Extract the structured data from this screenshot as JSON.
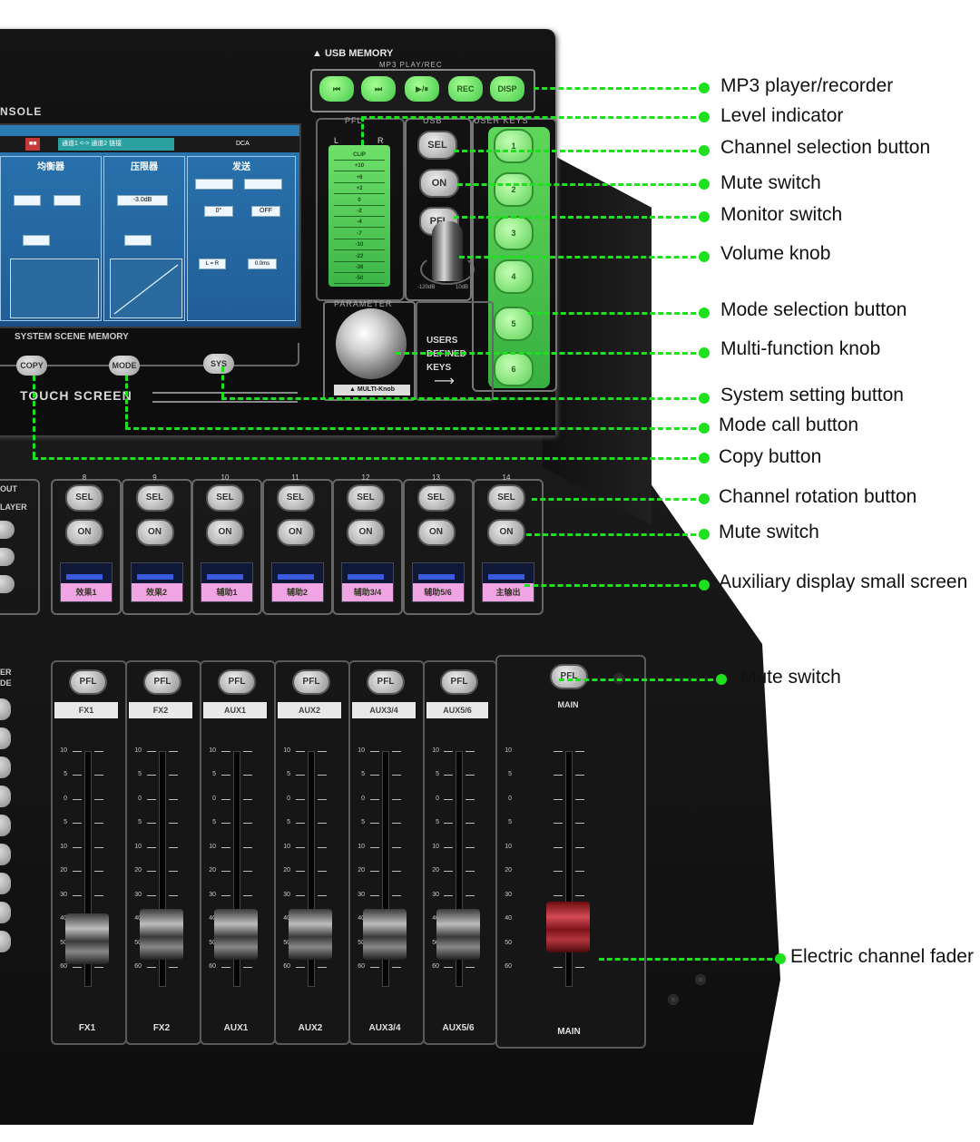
{
  "console": {
    "title": "NSOLE",
    "usb_memory_label": "USB MEMORY",
    "mp3_label": "MP3 PLAY/REC",
    "mp3_buttons": [
      "⏮",
      "⏭",
      "▶/⏸",
      "REC",
      "DISP"
    ],
    "section_labels": {
      "pfl": "PFL",
      "usb": "USB",
      "user_keys": "USER KEYS",
      "parameter": "PARAMETER"
    },
    "meter_labels": [
      "CLIP",
      "+10",
      "+6",
      "+2",
      "0",
      "-2",
      "-4",
      "-7",
      "-10",
      "-22",
      "-38",
      "-50"
    ],
    "usb_buttons": [
      "SEL",
      "ON",
      "PFL"
    ],
    "knob_scale": [
      "-120dB",
      "10dB"
    ],
    "user_keys": [
      "1",
      "2",
      "3",
      "4",
      "5",
      "6"
    ],
    "multi_knob_label": "MULTI-Knob",
    "user_defined_keys": "USERS DEFINED KEYS",
    "screen": {
      "tabs": [
        "通道1 <-> 通道2 链接",
        "DCA"
      ],
      "panels": [
        "均衡器",
        "压限器",
        "发送"
      ],
      "values": [
        "-3.0dB",
        "0°",
        "OFF",
        "L = R",
        "0.0ms"
      ]
    },
    "system_scene_memory": "SYSTEM SCENE MEMORY",
    "scene_buttons": [
      "COPY",
      "MODE",
      "SYS"
    ],
    "touch_screen": "TOUCH SCREEN",
    "left_edge": {
      "top_label": "OUT",
      "sub_label": "LAYER",
      "mode_label1": "ER",
      "mode_label2": "DE"
    }
  },
  "strips": {
    "numbers": [
      "8",
      "9",
      "10",
      "11",
      "12",
      "13",
      "14"
    ],
    "sel_label": "SEL",
    "on_label": "ON",
    "mini_screens": [
      "效果1",
      "效果2",
      "辅助1",
      "辅助2",
      "辅助3/4",
      "辅助5/6",
      "主输出"
    ]
  },
  "faders": {
    "pfl_label": "PFL",
    "names": [
      "FX1",
      "FX2",
      "AUX1",
      "AUX2",
      "AUX3/4",
      "AUX5/6",
      "MAIN"
    ],
    "scale": [
      "10",
      "5",
      "0",
      "5",
      "10",
      "20",
      "30",
      "40",
      "50",
      "60"
    ],
    "levels": [
      0.85,
      0.83,
      0.83,
      0.83,
      0.83,
      0.83,
      0.8
    ]
  },
  "callouts": [
    "MP3 player/recorder",
    "Level indicator",
    "Channel selection button",
    "Mute switch",
    "Monitor switch",
    "Volume knob",
    "Mode selection button",
    "Multi-function knob",
    "System setting button",
    "Mode call button",
    "Copy button",
    "Channel rotation button",
    "Mute switch",
    "Auxiliary display small screen",
    "Mute switch",
    "Electric channel fader"
  ],
  "colors": {
    "leader": "#1ee01e",
    "key_green": "#5fd05a",
    "main_fader": "#b5363f",
    "aux_pink": "#f0a4e4"
  }
}
